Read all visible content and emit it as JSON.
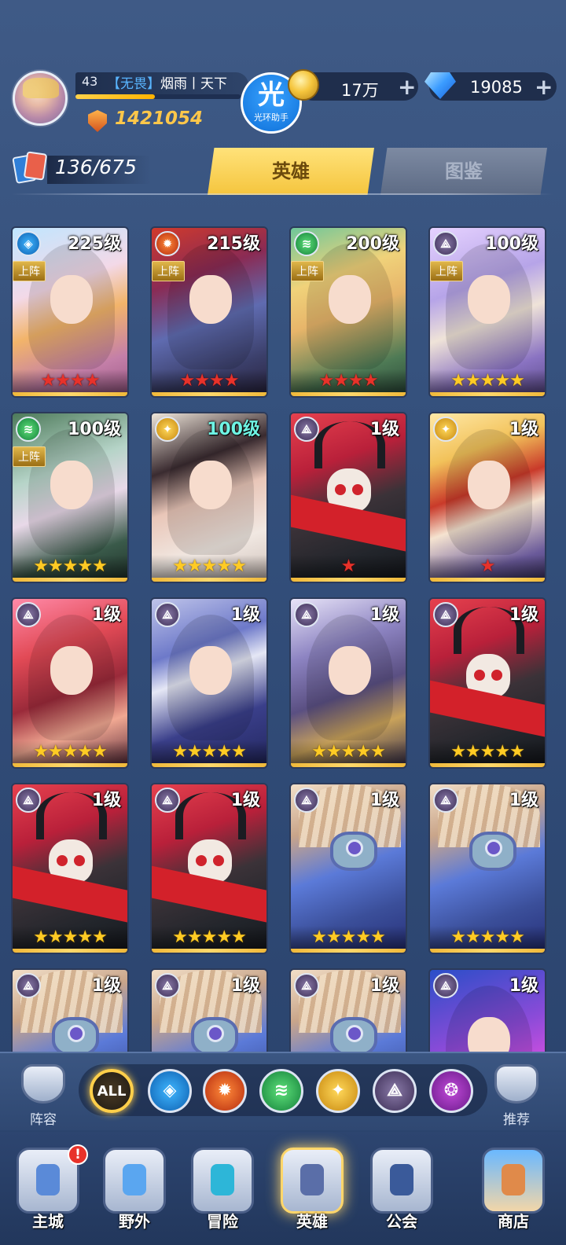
{
  "player": {
    "level": "43",
    "guild_tag": "【无畏】",
    "name": "烟雨丨天下",
    "exp_fraction": 0.48,
    "power": "1421054"
  },
  "helper": {
    "big": "光",
    "small": "光环助手"
  },
  "resources": {
    "coins": "17万",
    "gems": "19085"
  },
  "collection": {
    "count": "136/675"
  },
  "tabs": {
    "hero": "英雄",
    "dex": "图鉴"
  },
  "heroes": [
    {
      "level": "225级",
      "element": "water",
      "on_team": true,
      "team_label": "上阵",
      "stars": "★★★★",
      "star_color": "red",
      "art": "art-1"
    },
    {
      "level": "215级",
      "element": "fire",
      "on_team": true,
      "team_label": "上阵",
      "stars": "★★★★",
      "star_color": "red",
      "art": "art-2"
    },
    {
      "level": "200级",
      "element": "wind",
      "on_team": true,
      "team_label": "上阵",
      "stars": "★★★★",
      "star_color": "red",
      "art": "art-3"
    },
    {
      "level": "100级",
      "element": "dark",
      "on_team": true,
      "team_label": "上阵",
      "stars": "★★★★★",
      "star_color": "gold",
      "art": "art-4"
    },
    {
      "level": "100级",
      "element": "wind",
      "on_team": true,
      "team_label": "上阵",
      "stars": "★★★★★",
      "star_color": "gold",
      "art": "art-5"
    },
    {
      "level": "100级",
      "element": "light",
      "on_team": false,
      "stars": "★★★★★",
      "star_color": "gold",
      "art": "art-6",
      "cyan": true
    },
    {
      "level": "1级",
      "element": "dark",
      "on_team": false,
      "stars": "★",
      "star_color": "red",
      "art": "art-skull"
    },
    {
      "level": "1级",
      "element": "light",
      "on_team": false,
      "stars": "★",
      "star_color": "red",
      "art": "art-8"
    },
    {
      "level": "1级",
      "element": "dark",
      "on_team": false,
      "stars": "★★★★★",
      "star_color": "gold",
      "art": "art-9"
    },
    {
      "level": "1级",
      "element": "dark",
      "on_team": false,
      "stars": "★★★★★",
      "star_color": "gold",
      "art": "art-10"
    },
    {
      "level": "1级",
      "element": "dark",
      "on_team": false,
      "stars": "★★★★★",
      "star_color": "gold",
      "art": "art-11"
    },
    {
      "level": "1级",
      "element": "dark",
      "on_team": false,
      "stars": "★★★★★",
      "star_color": "gold",
      "art": "art-skull"
    },
    {
      "level": "1级",
      "element": "dark",
      "on_team": false,
      "stars": "★★★★★",
      "star_color": "gold",
      "art": "art-skull"
    },
    {
      "level": "1级",
      "element": "dark",
      "on_team": false,
      "stars": "★★★★★",
      "star_color": "gold",
      "art": "art-skull"
    },
    {
      "level": "1级",
      "element": "dark",
      "on_team": false,
      "stars": "★★★★★",
      "star_color": "gold",
      "art": "art-robot"
    },
    {
      "level": "1级",
      "element": "dark",
      "on_team": false,
      "stars": "★★★★★",
      "star_color": "gold",
      "art": "art-robot"
    },
    {
      "level": "1级",
      "element": "dark",
      "on_team": false,
      "stars": "",
      "star_color": "gold",
      "art": "art-robot"
    },
    {
      "level": "1级",
      "element": "dark",
      "on_team": false,
      "stars": "",
      "star_color": "gold",
      "art": "art-robot"
    },
    {
      "level": "1级",
      "element": "dark",
      "on_team": false,
      "stars": "",
      "star_color": "gold",
      "art": "art-robot"
    },
    {
      "level": "1级",
      "element": "dark",
      "on_team": false,
      "stars": "",
      "star_color": "gold",
      "art": "art-purple"
    }
  ],
  "filters": {
    "left_label": "阵容",
    "right_label": "推荐",
    "all_label": "ALL",
    "elements": [
      "water",
      "fire",
      "wind",
      "light",
      "dark",
      "purple"
    ]
  },
  "nav": [
    {
      "label": "主城",
      "icon": "castle-icon",
      "badge": "!"
    },
    {
      "label": "野外",
      "icon": "wild-icon"
    },
    {
      "label": "冒险",
      "icon": "adventure-icon"
    },
    {
      "label": "英雄",
      "icon": "hero-icon",
      "active": true
    },
    {
      "label": "公会",
      "icon": "guild-icon"
    },
    {
      "label": "商店",
      "icon": "shop-icon"
    }
  ],
  "colors": {
    "accent_gold": "#f5c53e",
    "star_red": "#e8322a",
    "star_gold": "#ffcb24",
    "bg": "#34507c"
  }
}
